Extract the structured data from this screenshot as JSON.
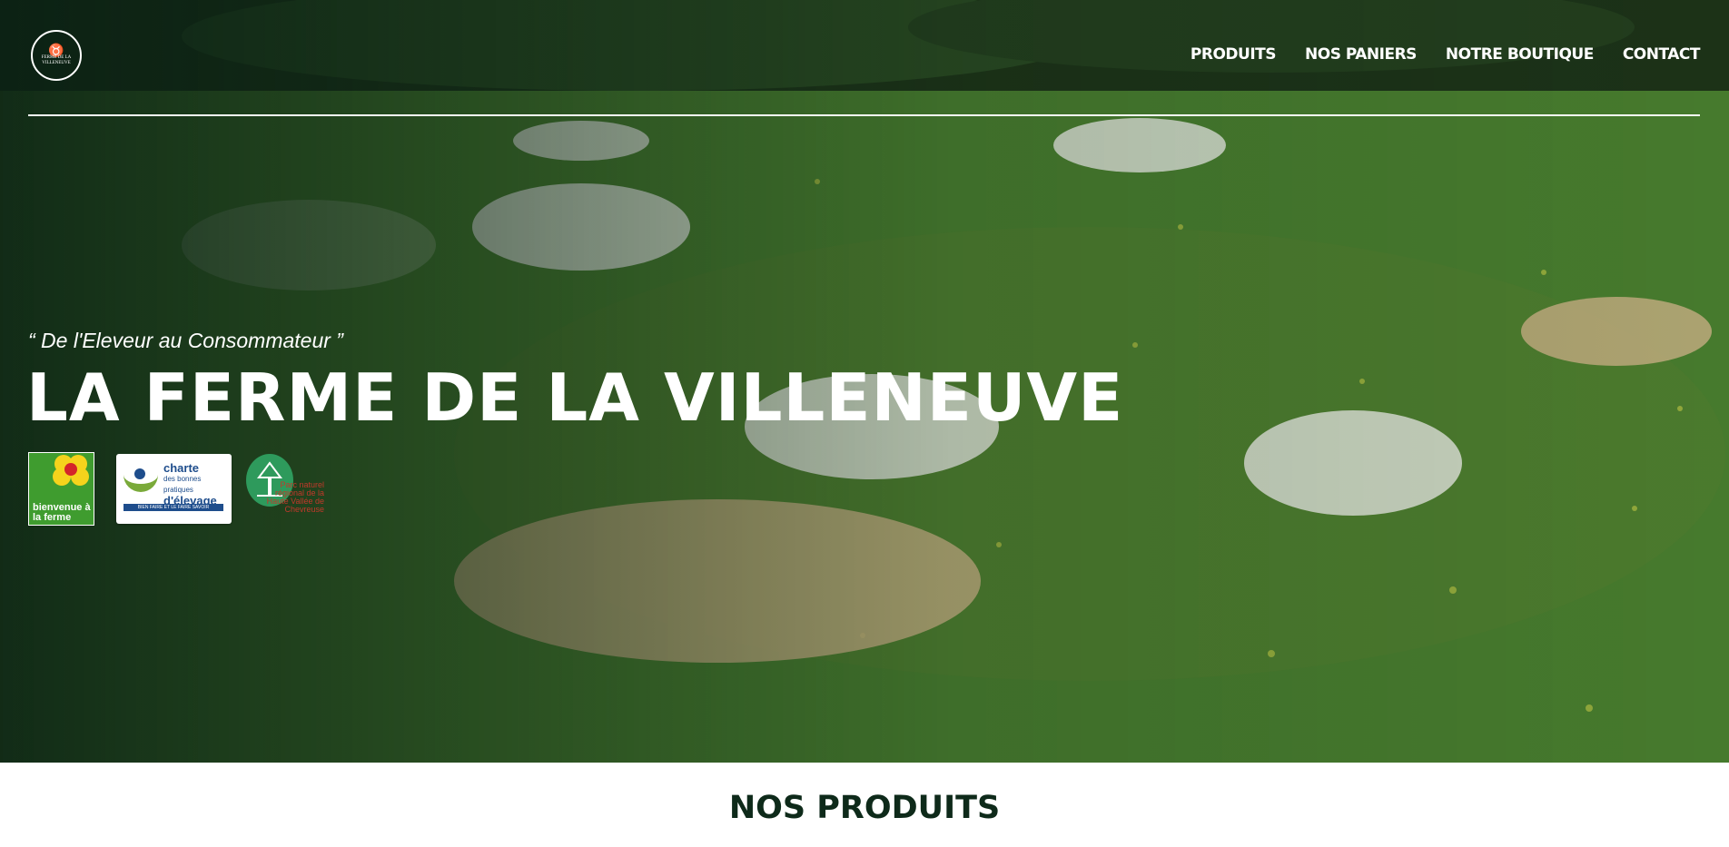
{
  "header": {
    "logo_text": "FERME DE LA VILLENEUVE",
    "nav": [
      {
        "label": "PRODUITS"
      },
      {
        "label": "NOS PANIERS"
      },
      {
        "label": "NOTRE BOUTIQUE"
      },
      {
        "label": "CONTACT"
      }
    ]
  },
  "hero": {
    "tagline": "“ De l'Eleveur au Consommateur ”",
    "title": "LA FERME DE LA VILLENEUVE",
    "badges": {
      "bienvenue": "bienvenue à la ferme",
      "charte_title": "charte",
      "charte_subtitle": "des bonnes pratiques",
      "charte_line": "d'élevage",
      "charte_strip": "BIEN FAIRE ET LE FAIRE SAVOIR",
      "parc": "Parc naturel régional de la Haute Vallée de Chevreuse"
    }
  },
  "section": {
    "title": "NOS PRODUITS"
  },
  "colors": {
    "overlay": "#0a2014",
    "section_title": "#0e2a1a",
    "nav_text": "#ffffff"
  }
}
